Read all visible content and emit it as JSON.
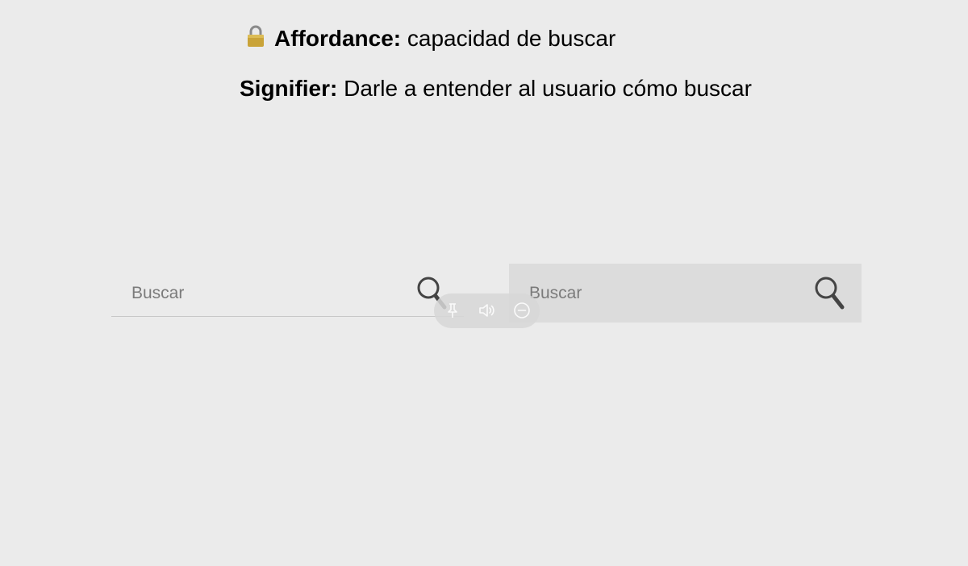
{
  "heading": {
    "affordance_label": "Affordance:",
    "affordance_text": " capacidad de buscar",
    "signifier_label": "Signifier:",
    "signifier_text": " Darle a entender al usuario cómo buscar"
  },
  "search_underlined": {
    "placeholder": "Buscar"
  },
  "search_filled": {
    "placeholder": "Buscar"
  },
  "media_bar": {
    "icons": [
      "pin-icon",
      "speaker-icon",
      "minus-circle-icon"
    ]
  },
  "colors": {
    "background": "#ebebeb",
    "filled_field": "#dcdcdc",
    "placeholder": "#7b7b7b"
  }
}
